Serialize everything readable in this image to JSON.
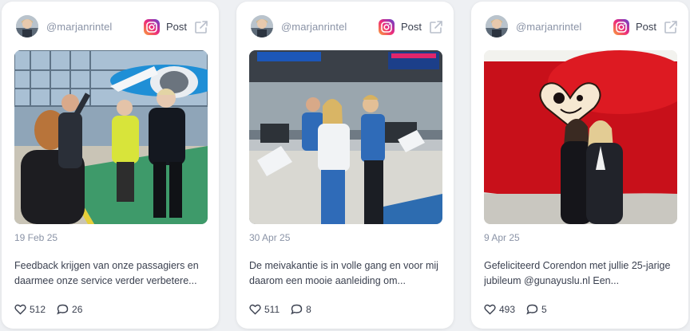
{
  "posts": [
    {
      "username": "@marjanrintel",
      "post_label": "Post",
      "date": "19 Feb 25",
      "caption": "Feedback krijgen van onze passagiers en daarmee onze service verder verbetere...",
      "likes": "512",
      "comments": "26",
      "photo": "hangar-airplane-team"
    },
    {
      "username": "@marjanrintel",
      "post_label": "Post",
      "date": "30 Apr 25",
      "caption": "De meivakantie is in volle gang en voor mij daarom een mooie aanleiding om...",
      "likes": "511",
      "comments": "8",
      "photo": "checkin-desk-staff"
    },
    {
      "username": "@marjanrintel",
      "post_label": "Post",
      "date": "9 Apr 25",
      "caption": "Gefeliciteerd Corendon met jullie 25-jarige jubileum @gunayuslu.nl Een...",
      "likes": "493",
      "comments": "5",
      "photo": "red-aircraft-two-women"
    }
  ],
  "icons": {
    "brand": "instagram-icon",
    "external": "external-link-icon",
    "likes": "heart-icon",
    "comments": "comment-icon"
  },
  "colors": {
    "card_bg": "#ffffff",
    "page_bg": "#eef0f3",
    "muted_text": "#8a93a6",
    "body_text": "#3b4150"
  }
}
